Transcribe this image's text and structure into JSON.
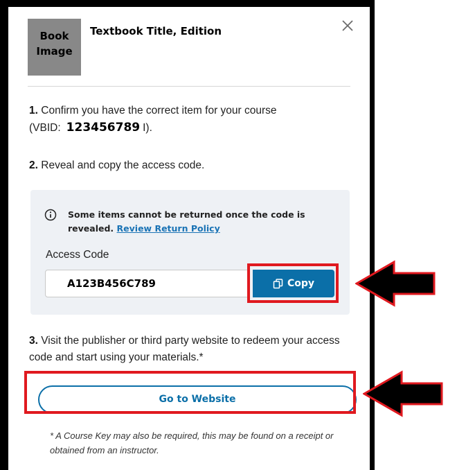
{
  "header": {
    "book_image_label": "Book Image",
    "title": "Textbook Title, Edition",
    "close_icon": "close-icon"
  },
  "steps": {
    "step1": {
      "number": "1.",
      "text": "Confirm you have the correct item for your course",
      "vbid_label": "(VBID:",
      "vbid_value": "123456789",
      "vbid_close": "I)."
    },
    "step2": {
      "number": "2.",
      "text": "Reveal and copy the access code."
    },
    "step3": {
      "number": "3.",
      "text": "Visit the publisher or third party website to redeem your access code and start using your materials.*"
    }
  },
  "code_panel": {
    "info_icon": "info-icon",
    "notice": "Some items cannot be returned once the code is revealed.",
    "policy_link": "Review Return Policy",
    "label": "Access Code",
    "code_value": "A123B456C789",
    "copy_label": "Copy",
    "copy_icon": "copy-icon"
  },
  "website_button": "Go to Website",
  "footnote": "* A Course Key may also be required, this may be found on a receipt or obtained from an instructor.",
  "colors": {
    "primary": "#0b6fa8",
    "highlight": "#e0191f",
    "panel_bg": "#eef1f5",
    "image_placeholder": "#888888"
  }
}
